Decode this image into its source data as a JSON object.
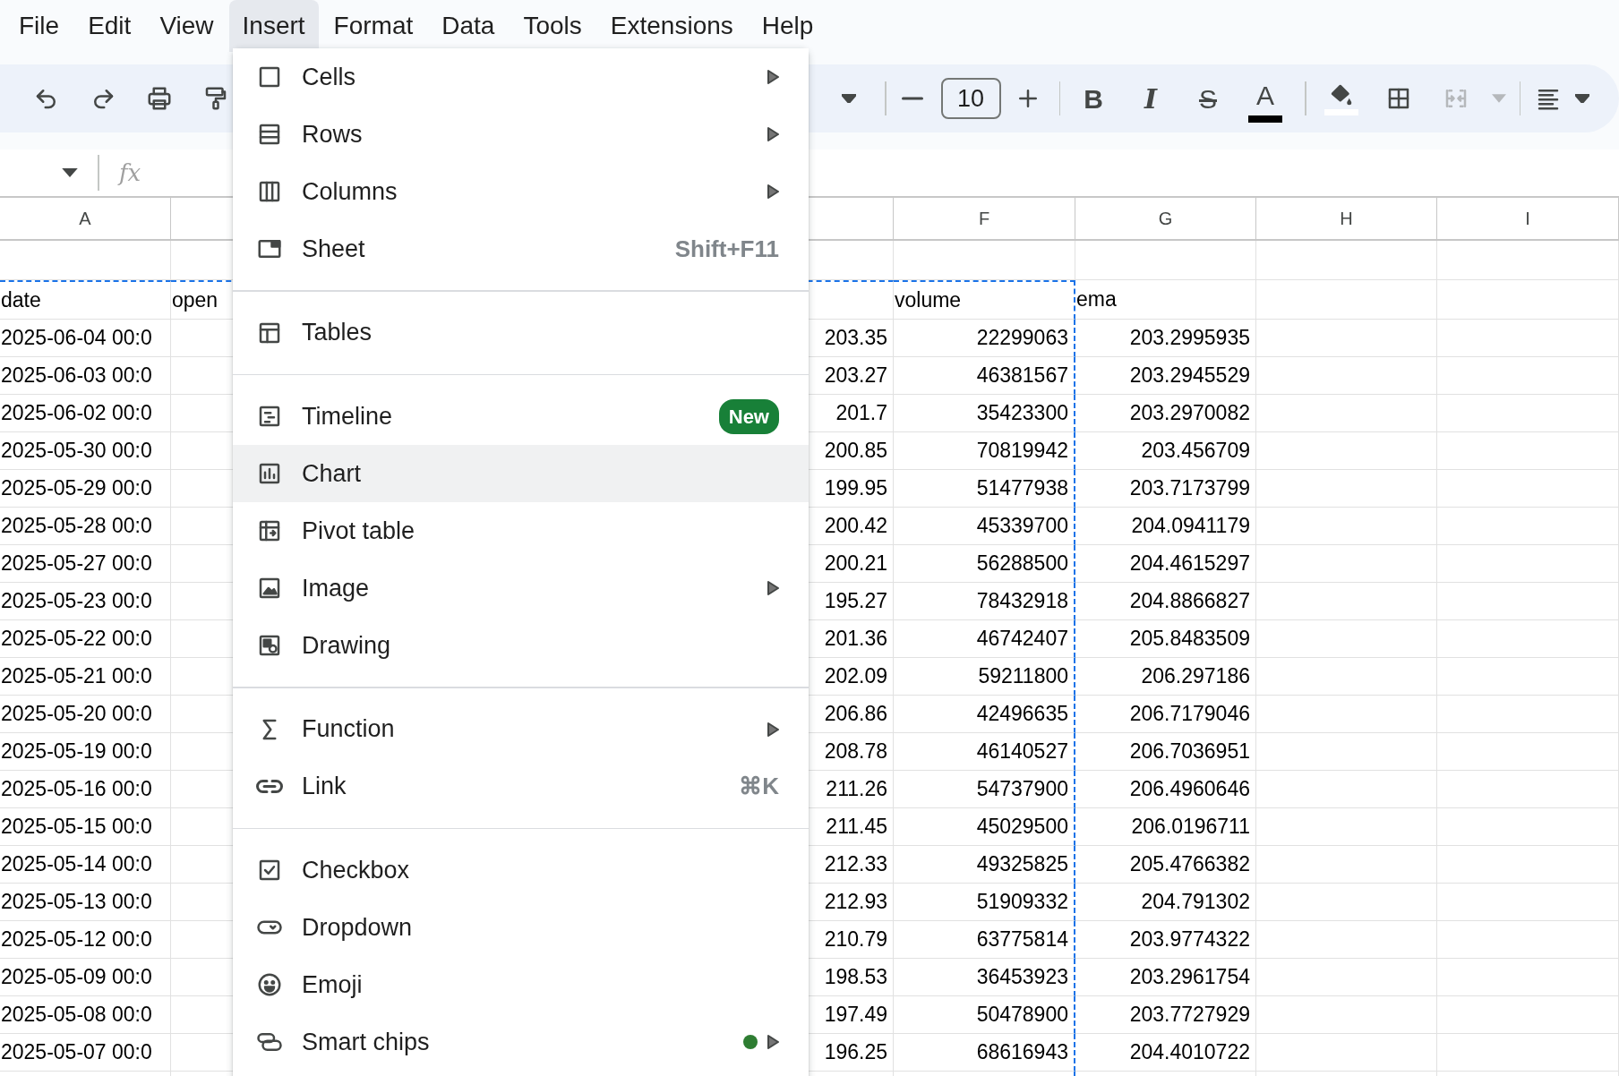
{
  "menu_bar": [
    {
      "label": "File",
      "open": false
    },
    {
      "label": "Edit",
      "open": false
    },
    {
      "label": "View",
      "open": false
    },
    {
      "label": "Insert",
      "open": true
    },
    {
      "label": "Format",
      "open": false
    },
    {
      "label": "Data",
      "open": false
    },
    {
      "label": "Tools",
      "open": false
    },
    {
      "label": "Extensions",
      "open": false
    },
    {
      "label": "Help",
      "open": false
    }
  ],
  "toolbar": {
    "font_size": "10",
    "format_buttons": [
      {
        "glyph": "B"
      },
      {
        "glyph": "I"
      },
      {
        "glyph": "S"
      },
      {
        "glyph": "A"
      }
    ],
    "merge_disabled": true
  },
  "formula_bar": {
    "label": "fx"
  },
  "columns": [
    {
      "header": "A"
    },
    {},
    {},
    {},
    {},
    {
      "header": "F"
    },
    {
      "header": "G"
    },
    {
      "header": "H"
    },
    {
      "header": "I"
    }
  ],
  "rows": [
    {
      "kind": "blank",
      "copied": false
    },
    {
      "kind": "header",
      "copied": true,
      "cells": {
        "A": "date",
        "B": "open",
        "F": "volume",
        "G": "ema"
      }
    },
    {
      "kind": "data",
      "copied": true,
      "cells": {
        "A": "2025-06-04 00:0",
        "E": "203.35",
        "F": "22299063",
        "G": "203.2995935"
      }
    },
    {
      "kind": "data",
      "copied": true,
      "cells": {
        "A": "2025-06-03 00:0",
        "E": "203.27",
        "F": "46381567",
        "G": "203.2945529"
      }
    },
    {
      "kind": "data",
      "copied": true,
      "cells": {
        "A": "2025-06-02 00:0",
        "E": "201.7",
        "F": "35423300",
        "G": "203.2970082"
      }
    },
    {
      "kind": "data",
      "copied": true,
      "cells": {
        "A": "2025-05-30 00:0",
        "E": "200.85",
        "F": "70819942",
        "G": "203.456709"
      }
    },
    {
      "kind": "data",
      "copied": true,
      "cells": {
        "A": "2025-05-29 00:0",
        "E": "199.95",
        "F": "51477938",
        "G": "203.7173799"
      }
    },
    {
      "kind": "data",
      "copied": true,
      "cells": {
        "A": "2025-05-28 00:0",
        "E": "200.42",
        "F": "45339700",
        "G": "204.0941179"
      }
    },
    {
      "kind": "data",
      "copied": true,
      "cells": {
        "A": "2025-05-27 00:0",
        "E": "200.21",
        "F": "56288500",
        "G": "204.4615297"
      }
    },
    {
      "kind": "data",
      "copied": true,
      "cells": {
        "A": "2025-05-23 00:0",
        "E": "195.27",
        "F": "78432918",
        "G": "204.8866827"
      }
    },
    {
      "kind": "data",
      "copied": true,
      "cells": {
        "A": "2025-05-22 00:0",
        "E": "201.36",
        "F": "46742407",
        "G": "205.8483509"
      }
    },
    {
      "kind": "data",
      "copied": true,
      "cells": {
        "A": "2025-05-21 00:0",
        "E": "202.09",
        "F": "59211800",
        "G": "206.297186"
      }
    },
    {
      "kind": "data",
      "copied": true,
      "cells": {
        "A": "2025-05-20 00:0",
        "E": "206.86",
        "F": "42496635",
        "G": "206.7179046"
      }
    },
    {
      "kind": "data",
      "copied": true,
      "cells": {
        "A": "2025-05-19 00:0",
        "E": "208.78",
        "F": "46140527",
        "G": "206.7036951"
      }
    },
    {
      "kind": "data",
      "copied": true,
      "cells": {
        "A": "2025-05-16 00:0",
        "E": "211.26",
        "F": "54737900",
        "G": "206.4960646"
      }
    },
    {
      "kind": "data",
      "copied": true,
      "cells": {
        "A": "2025-05-15 00:0",
        "E": "211.45",
        "F": "45029500",
        "G": "206.0196711"
      }
    },
    {
      "kind": "data",
      "copied": true,
      "cells": {
        "A": "2025-05-14 00:0",
        "E": "212.33",
        "F": "49325825",
        "G": "205.4766382"
      }
    },
    {
      "kind": "data",
      "copied": true,
      "cells": {
        "A": "2025-05-13 00:0",
        "E": "212.93",
        "F": "51909332",
        "G": "204.791302"
      }
    },
    {
      "kind": "data",
      "copied": true,
      "cells": {
        "A": "2025-05-12 00:0",
        "E": "210.79",
        "F": "63775814",
        "G": "203.9774322"
      }
    },
    {
      "kind": "data",
      "copied": true,
      "cells": {
        "A": "2025-05-09 00:0",
        "E": "198.53",
        "F": "36453923",
        "G": "203.2961754"
      }
    },
    {
      "kind": "data",
      "copied": true,
      "cells": {
        "A": "2025-05-08 00:0",
        "E": "197.49",
        "F": "50478900",
        "G": "203.7727929"
      }
    },
    {
      "kind": "data",
      "copied": true,
      "cells": {
        "A": "2025-05-07 00:0",
        "E": "196.25",
        "F": "68616943",
        "G": "204.4010722"
      }
    },
    {
      "kind": "blank",
      "copied": true
    }
  ],
  "insert_menu": [
    {
      "kind": "item",
      "label": "Cells",
      "submenu": true,
      "highlighted": false,
      "dot": false
    },
    {
      "kind": "item",
      "label": "Rows",
      "submenu": true,
      "highlighted": false,
      "dot": false
    },
    {
      "kind": "item",
      "label": "Columns",
      "submenu": true,
      "highlighted": false,
      "dot": false
    },
    {
      "kind": "item",
      "label": "Sheet",
      "shortcut": "Shift+F11",
      "submenu": false,
      "highlighted": false,
      "dot": false
    },
    {
      "kind": "separator"
    },
    {
      "kind": "item",
      "label": "Tables",
      "submenu": false,
      "highlighted": false,
      "dot": false
    },
    {
      "kind": "separator"
    },
    {
      "kind": "item",
      "label": "Timeline",
      "badge": "New",
      "submenu": false,
      "highlighted": false,
      "dot": false
    },
    {
      "kind": "item",
      "label": "Chart",
      "submenu": false,
      "highlighted": true,
      "dot": false
    },
    {
      "kind": "item",
      "label": "Pivot table",
      "submenu": false,
      "highlighted": false,
      "dot": false
    },
    {
      "kind": "item",
      "label": "Image",
      "submenu": true,
      "highlighted": false,
      "dot": false
    },
    {
      "kind": "item",
      "label": "Drawing",
      "submenu": false,
      "highlighted": false,
      "dot": false
    },
    {
      "kind": "separator"
    },
    {
      "kind": "item",
      "label": "Function",
      "submenu": true,
      "highlighted": false,
      "dot": false
    },
    {
      "kind": "item",
      "label": "Link",
      "shortcut": "⌘K",
      "submenu": false,
      "highlighted": false,
      "dot": false
    },
    {
      "kind": "separator"
    },
    {
      "kind": "item",
      "label": "Checkbox",
      "submenu": false,
      "highlighted": false,
      "dot": false
    },
    {
      "kind": "item",
      "label": "Dropdown",
      "submenu": false,
      "highlighted": false,
      "dot": false
    },
    {
      "kind": "item",
      "label": "Emoji",
      "submenu": false,
      "highlighted": false,
      "dot": false
    },
    {
      "kind": "item",
      "label": "Smart chips",
      "submenu": true,
      "highlighted": false,
      "dot": true
    }
  ]
}
